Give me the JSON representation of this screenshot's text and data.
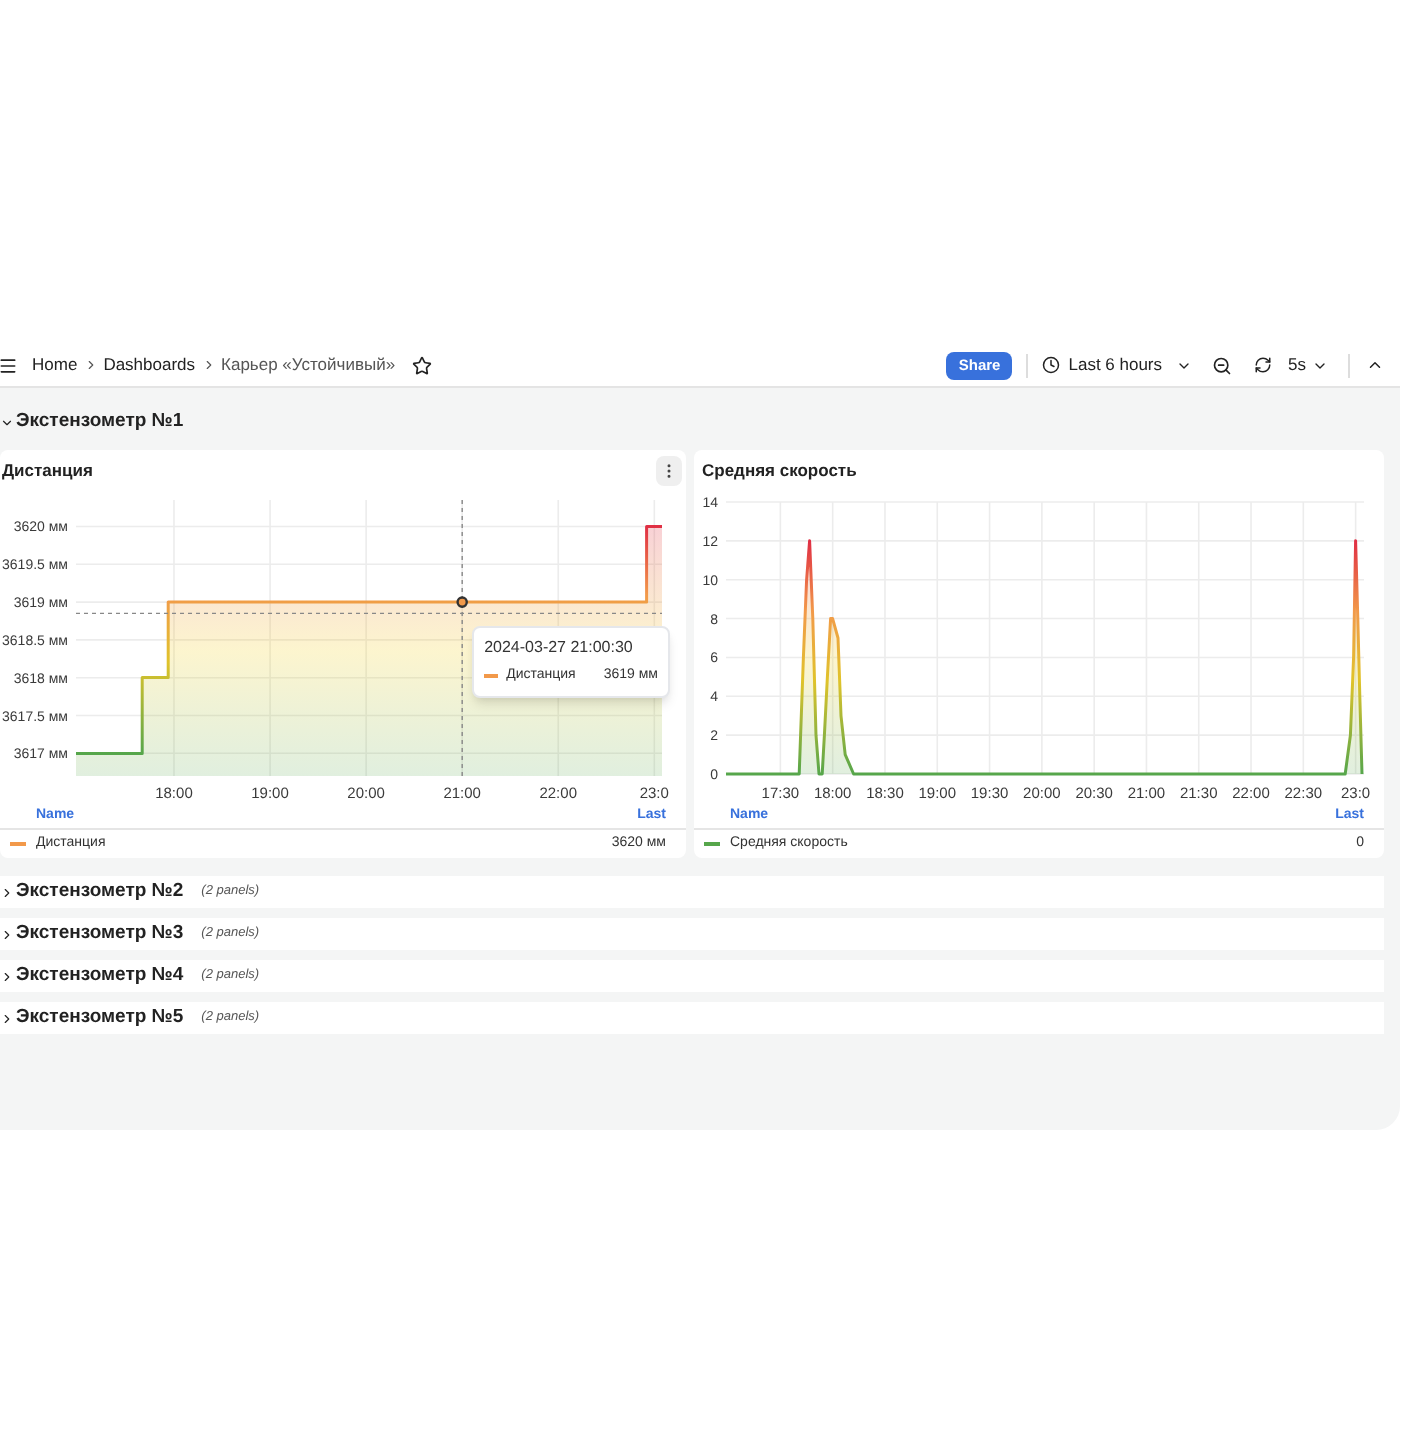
{
  "topbar": {
    "breadcrumbs": [
      {
        "label": "Home",
        "current": false
      },
      {
        "label": "Dashboards",
        "current": false
      },
      {
        "label": "Карьер «Устойчивый»",
        "current": true
      }
    ],
    "starred": false,
    "share": "Share",
    "time_range": "Last 6 hours",
    "refresh": "5s"
  },
  "rows": [
    {
      "title": "Экстензометр №1",
      "expanded": true,
      "panels": [
        {
          "title": "Дистанция",
          "menu": true,
          "chart_data": {
            "type": "area",
            "grid": true,
            "x": [
              16.98,
              17.67,
              17.67,
              17.94,
              17.94,
              22.92,
              22.92,
              23.08
            ],
            "series": [
              {
                "name": "Дистанция",
                "color": "#f2994a",
                "values": [
                  3617,
                  3617,
                  3618,
                  3618,
                  3619,
                  3619,
                  3620,
                  3620
                ]
              }
            ],
            "xlim": [
              16.98,
              23.08
            ],
            "ylim": [
              3616.7,
              3620.35
            ],
            "ref_lines": [
              {
                "axis": "x",
                "value": 21
              },
              {
                "axis": "y",
                "value": 3618.85
              }
            ],
            "xticks": [
              {
                "value": 18,
                "label": "18:00"
              },
              {
                "value": 19,
                "label": "19:00"
              },
              {
                "value": 20,
                "label": "20:00"
              },
              {
                "value": 21,
                "label": "21:00"
              },
              {
                "value": 22,
                "label": "22:00"
              },
              {
                "value": 23,
                "label": "23:0"
              }
            ],
            "yticks": [
              {
                "value": 3617,
                "label": "3617 мм"
              },
              {
                "value": 3617.5,
                "label": "3617.5 мм"
              },
              {
                "value": 3618,
                "label": "3618 мм"
              },
              {
                "value": 3618.5,
                "label": "3618.5 мм"
              },
              {
                "value": 3619,
                "label": "3619 мм"
              },
              {
                "value": 3619.5,
                "label": "3619.5 мм"
              },
              {
                "value": 3620,
                "label": "3620 мм"
              }
            ]
          },
          "tooltip": {
            "time": "2024-03-27 21:00:30",
            "name": "Дистанция",
            "value": "3619 мм"
          },
          "legend": {
            "name_header": "Name",
            "last_header": "Last",
            "last": [
              "3620 мм"
            ]
          }
        },
        {
          "title": "Средняя скорость",
          "menu": false,
          "chart_data": {
            "type": "area",
            "grid": true,
            "x": [
              16.98,
              17.68,
              17.72,
              17.75,
              17.78,
              17.81,
              17.84,
              17.87,
              17.9,
              17.92,
              17.95,
              17.98,
              18.0,
              18.05,
              18.08,
              18.12,
              18.2,
              22.9,
              22.95,
              22.98,
              23.0,
              23.02,
              23.04,
              23.06
            ],
            "series": [
              {
                "name": "Средняя скорость",
                "color": "#56a64b",
                "values": [
                  0,
                  0,
                  6,
                  10,
                  12,
                  8,
                  2,
                  0,
                  0,
                  2,
                  5,
                  8,
                  8,
                  7,
                  3,
                  1,
                  0,
                  0,
                  2,
                  6,
                  12,
                  8,
                  4,
                  0
                ]
              }
            ],
            "xlim": [
              16.98,
              23.08
            ],
            "ylim": [
              0,
              14
            ],
            "xticks": [
              {
                "value": 17.5,
                "label": "17:30"
              },
              {
                "value": 18,
                "label": "18:00"
              },
              {
                "value": 18.5,
                "label": "18:30"
              },
              {
                "value": 19,
                "label": "19:00"
              },
              {
                "value": 19.5,
                "label": "19:30"
              },
              {
                "value": 20,
                "label": "20:00"
              },
              {
                "value": 20.5,
                "label": "20:30"
              },
              {
                "value": 21,
                "label": "21:00"
              },
              {
                "value": 21.5,
                "label": "21:30"
              },
              {
                "value": 22,
                "label": "22:00"
              },
              {
                "value": 22.5,
                "label": "22:30"
              },
              {
                "value": 23,
                "label": "23:0"
              }
            ],
            "yticks": [
              0,
              2,
              4,
              6,
              8,
              10,
              12,
              14
            ]
          },
          "legend": {
            "name_header": "Name",
            "last_header": "Last",
            "last": [
              "0"
            ]
          }
        }
      ]
    },
    {
      "title": "Экстензометр №2",
      "expanded": false,
      "note": "(2 panels)"
    },
    {
      "title": "Экстензометр №3",
      "expanded": false,
      "note": "(2 panels)"
    },
    {
      "title": "Экстензометр №4",
      "expanded": false,
      "note": "(2 panels)"
    },
    {
      "title": "Экстензометр №5",
      "expanded": false,
      "note": "(2 panels)"
    }
  ]
}
